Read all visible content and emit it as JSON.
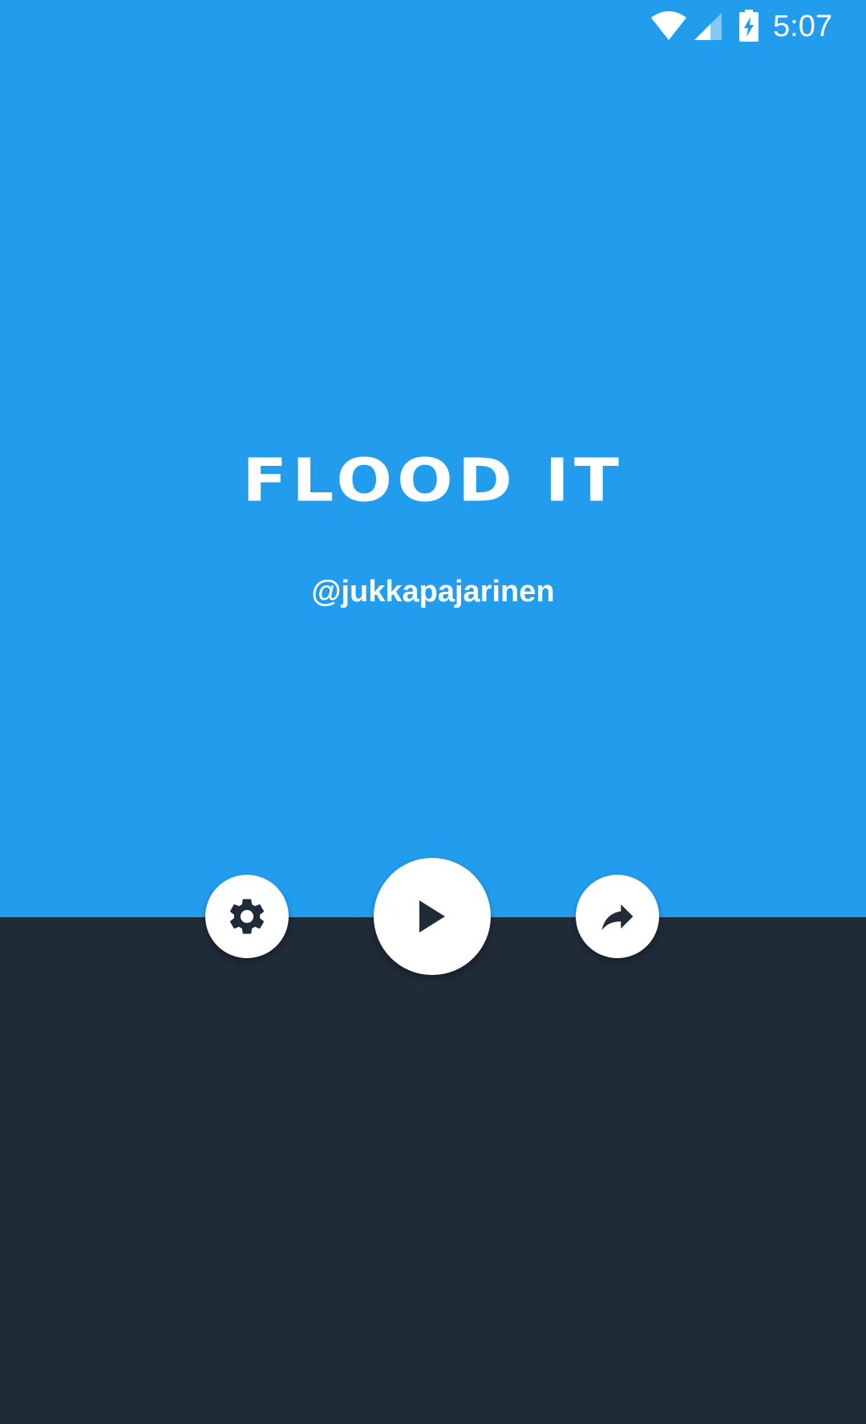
{
  "status_bar": {
    "time": "5:07",
    "icons": [
      "wifi-icon",
      "cellular-signal-icon",
      "battery-charging-icon"
    ]
  },
  "title": "FLOOD IT",
  "author": "@jukkapajarinen",
  "buttons": {
    "settings": {
      "icon": "gear-icon"
    },
    "play": {
      "icon": "play-icon"
    },
    "share": {
      "icon": "share-icon"
    }
  },
  "colors": {
    "top_background": "#229ded",
    "bottom_background": "#202b38",
    "button_background": "#ffffff",
    "icon_color": "#202b38",
    "text_color": "#ffffff"
  }
}
